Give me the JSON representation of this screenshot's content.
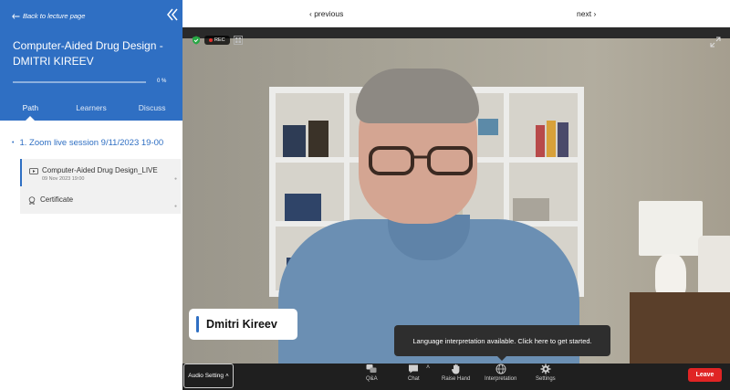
{
  "sidebar": {
    "back_label": "Back to lecture page",
    "course_title": "Computer-Aided Drug Design - DMITRI KIREEV",
    "progress_percent": 0,
    "progress_label": "0 %",
    "tabs": [
      {
        "label": "Path",
        "active": true
      },
      {
        "label": "Learners",
        "active": false
      },
      {
        "label": "Discuss",
        "active": false
      }
    ],
    "section_title": "1. Zoom live session 9/11/2023 19-00",
    "lessons": [
      {
        "title": "Computer-Aided Drug Design_LIVE",
        "date": "09 Nov 2023 19:00",
        "icon": "video-icon"
      },
      {
        "title": "Certificate",
        "date": "",
        "icon": "certificate-icon"
      }
    ]
  },
  "topnav": {
    "previous_label": "previous",
    "next_label": "next"
  },
  "meeting": {
    "rec_label": "REC",
    "speaker_name": "Dmitri Kireev",
    "interpretation_tooltip": "Language interpretation available. Click here to get started."
  },
  "toolbar": {
    "audio_label": "Audio Setting",
    "items": [
      {
        "label": "Q&A",
        "icon": "qa-icon"
      },
      {
        "label": "Chat",
        "icon": "chat-icon"
      },
      {
        "label": "Raise Hand",
        "icon": "hand-icon"
      },
      {
        "label": "Interpretation",
        "icon": "globe-icon"
      },
      {
        "label": "Settings",
        "icon": "gear-icon"
      }
    ],
    "leave_label": "Leave"
  },
  "colors": {
    "brand_blue": "#2f6fc3",
    "leave_red": "#e02424",
    "toolbar_bg": "#1f1f1f"
  }
}
